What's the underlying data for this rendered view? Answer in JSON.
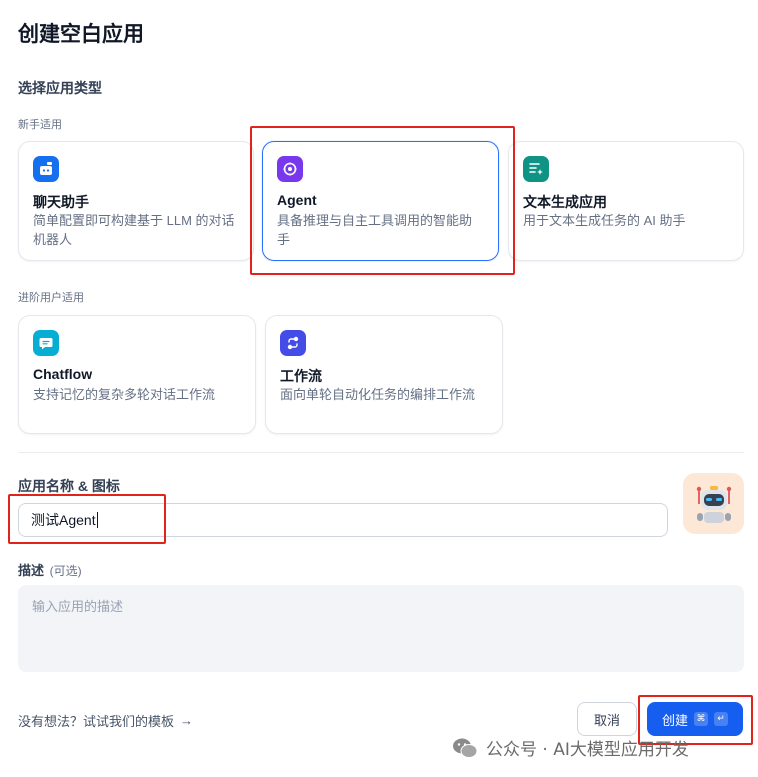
{
  "dialog": {
    "title": "创建空白应用",
    "select_type_label": "选择应用类型",
    "beginner_group_label": "新手适用",
    "advanced_group_label": "进阶用户适用"
  },
  "app_types": {
    "chatbot": {
      "title": "聊天助手",
      "desc_line1": "简单配置即可构建基于 LLM 的对话",
      "desc_line2": "机器人",
      "icon": "chat-bot-icon",
      "color": "#1570ef"
    },
    "agent": {
      "title": "Agent",
      "desc_line1": "具备推理与自主工具调用的智能助",
      "desc_line2": "手",
      "icon": "agent-icon",
      "color": "#7839ee",
      "selected": true
    },
    "text_gen": {
      "title": "文本生成应用",
      "desc_line1": "用于文本生成任务的 AI 助手",
      "icon": "text-generation-icon",
      "color": "#0e9384"
    },
    "chatflow": {
      "title": "Chatflow",
      "desc_line1": "支持记忆的复杂多轮对话工作流",
      "icon": "chatflow-icon",
      "color": "#06aed4"
    },
    "workflow": {
      "title": "工作流",
      "desc_line1": "面向单轮自动化任务的编排工作流",
      "icon": "workflow-icon",
      "color": "#444ce7"
    }
  },
  "name_section": {
    "label": "应用名称 & 图标",
    "value": "测试Agent",
    "app_icon": "robot-emoji-icon",
    "app_icon_bg": "#fde8d7"
  },
  "description_section": {
    "label": "描述",
    "optional": "(可选)",
    "placeholder": "输入应用的描述"
  },
  "footer": {
    "template_link": "没有想法？试试我们的模板",
    "cancel_label": "取消",
    "create_label": "创建",
    "shortcut_cmd": "⌘",
    "shortcut_enter": "↵"
  },
  "watermark": {
    "text": "公众号 · AI大模型应用开发"
  },
  "colors": {
    "primary": "#155eef",
    "selected_border": "#2970ff",
    "annotation_red": "#e0231b"
  }
}
